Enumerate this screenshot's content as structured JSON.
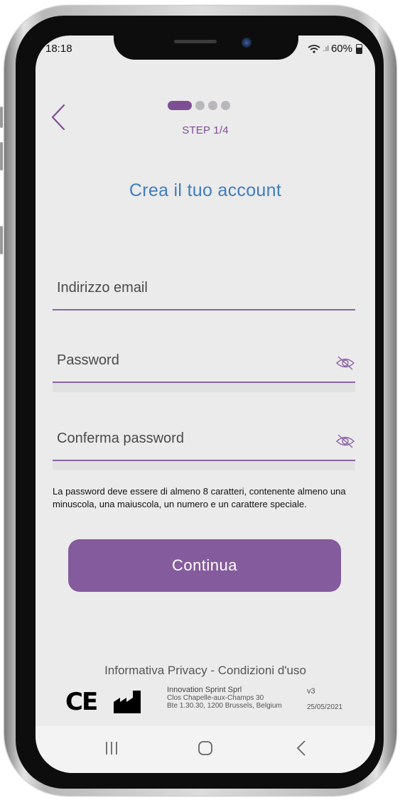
{
  "status_bar": {
    "time": "18:18",
    "battery": "60%"
  },
  "header": {
    "step_label": "STEP 1/4",
    "steps_total": 4,
    "steps_current": 1
  },
  "page": {
    "title": "Crea il tuo account"
  },
  "form": {
    "email_label": "Indirizzo email",
    "password_label": "Password",
    "confirm_label": "Conferma password",
    "password_hint": "La password deve essere di almeno 8 caratteri, contenente almeno una minuscola, una maiuscola, un numero e un carattere speciale."
  },
  "actions": {
    "continue_label": "Continua"
  },
  "footer": {
    "links": "Informativa Privacy - Condizioni d'uso",
    "ce_mark": "CE",
    "company_name": "Innovation Sprint Sprl",
    "address_line1": "Clos Chapelle-aux-Champs 30",
    "address_line2": "Bte 1.30.30, 1200 Brussels, Belgium",
    "version": "v3",
    "date": "25/05/2021"
  },
  "colors": {
    "accent": "#845b9c",
    "title_blue": "#3f7dbd",
    "background": "#ebebeb"
  },
  "icons": [
    "back-chevron-icon",
    "eye-off-icon",
    "factory-icon",
    "recent-apps-icon",
    "home-icon",
    "back-icon",
    "wifi-icon",
    "battery-icon"
  ]
}
